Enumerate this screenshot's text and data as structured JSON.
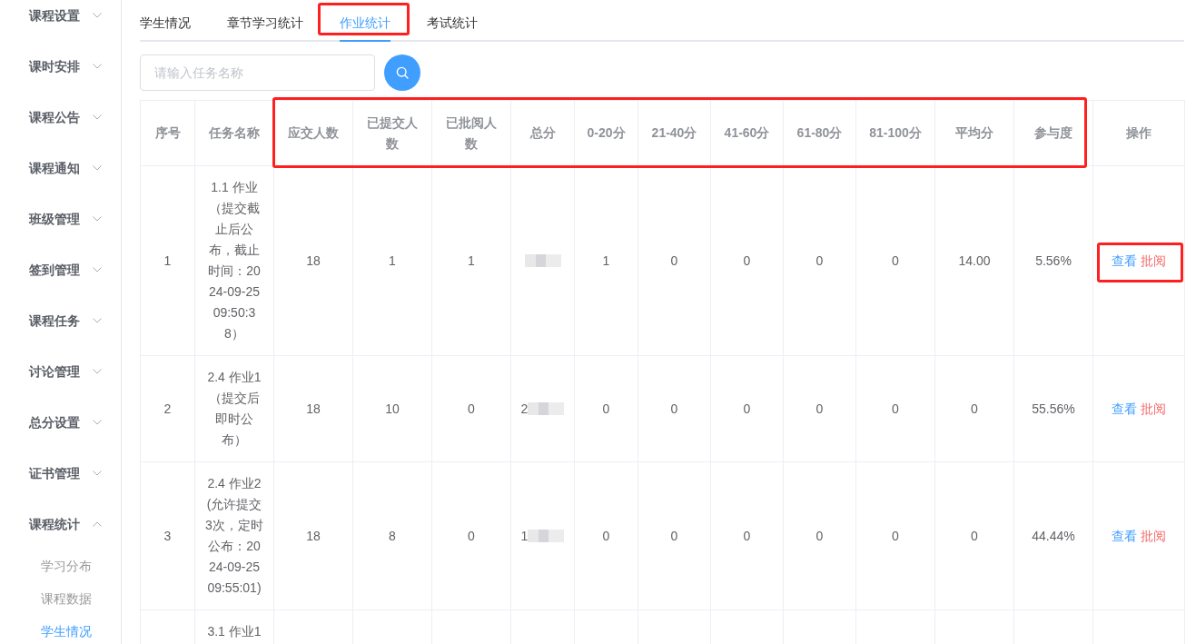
{
  "sidebar": {
    "items": [
      {
        "label": "课程设置",
        "expanded": false
      },
      {
        "label": "课时安排",
        "expanded": false
      },
      {
        "label": "课程公告",
        "expanded": false
      },
      {
        "label": "课程通知",
        "expanded": false
      },
      {
        "label": "班级管理",
        "expanded": false
      },
      {
        "label": "签到管理",
        "expanded": false
      },
      {
        "label": "课程任务",
        "expanded": false
      },
      {
        "label": "讨论管理",
        "expanded": false
      },
      {
        "label": "总分设置",
        "expanded": false
      },
      {
        "label": "证书管理",
        "expanded": false
      },
      {
        "label": "课程统计",
        "expanded": true,
        "children": [
          {
            "label": "学习分布",
            "selected": false
          },
          {
            "label": "课程数据",
            "selected": false
          },
          {
            "label": "学生情况",
            "selected": true
          }
        ]
      }
    ]
  },
  "tabs": [
    {
      "label": "学生情况",
      "selected": false,
      "highlighted": false
    },
    {
      "label": "章节学习统计",
      "selected": false,
      "highlighted": false
    },
    {
      "label": "作业统计",
      "selected": true,
      "highlighted": true
    },
    {
      "label": "考试统计",
      "selected": false,
      "highlighted": false
    }
  ],
  "search": {
    "placeholder": "请输入任务名称"
  },
  "table": {
    "column_groups": [
      {
        "highlighted": false,
        "columns": [
          {
            "label": "序号"
          },
          {
            "label": "任务名称"
          }
        ]
      },
      {
        "highlighted": true,
        "columns": [
          {
            "label": "应交人数"
          },
          {
            "label": "已提交人数"
          },
          {
            "label": "已批阅人数"
          },
          {
            "label": "总分"
          },
          {
            "label": "0-20分"
          },
          {
            "label": "21-40分"
          },
          {
            "label": "41-60分"
          },
          {
            "label": "61-80分"
          },
          {
            "label": "81-100分"
          },
          {
            "label": "平均分"
          },
          {
            "label": "参与度"
          }
        ]
      },
      {
        "highlighted": false,
        "columns": [
          {
            "label": "操作"
          }
        ]
      }
    ],
    "rows": [
      {
        "index": "1",
        "task": "1.1 作业（提交截止后公布，截止时间：2024-09-25 09:50:38）",
        "due": "18",
        "submitted": "1",
        "reviewed": "1",
        "total": {
          "redacted": true
        },
        "bands": [
          "1",
          "0",
          "0",
          "0",
          "0"
        ],
        "average": "14.00",
        "participation": "5.56%",
        "actions": [
          {
            "label": "查看",
            "kind": "view"
          },
          {
            "label": "批阅",
            "kind": "review"
          }
        ],
        "actions_highlighted": true
      },
      {
        "index": "2",
        "task": "2.4 作业1（提交后即时公布）",
        "due": "18",
        "submitted": "10",
        "reviewed": "0",
        "total": {
          "text": "2",
          "redacted": true
        },
        "bands": [
          "0",
          "0",
          "0",
          "0",
          "0"
        ],
        "average": "0",
        "participation": "55.56%",
        "actions": [
          {
            "label": "查看",
            "kind": "view"
          },
          {
            "label": "批阅",
            "kind": "review"
          }
        ],
        "actions_highlighted": false
      },
      {
        "index": "3",
        "task": "2.4 作业2(允许提交3次，定时公布：2024-09-25 09:55:01)",
        "due": "18",
        "submitted": "8",
        "reviewed": "0",
        "total": {
          "text": "1",
          "redacted": true
        },
        "bands": [
          "0",
          "0",
          "0",
          "0",
          "0"
        ],
        "average": "0",
        "participation": "44.44%",
        "actions": [
          {
            "label": "查看",
            "kind": "view"
          },
          {
            "label": "批阅",
            "kind": "review"
          }
        ],
        "actions_highlighted": false
      },
      {
        "task": "3.1 作业1"
      }
    ]
  }
}
